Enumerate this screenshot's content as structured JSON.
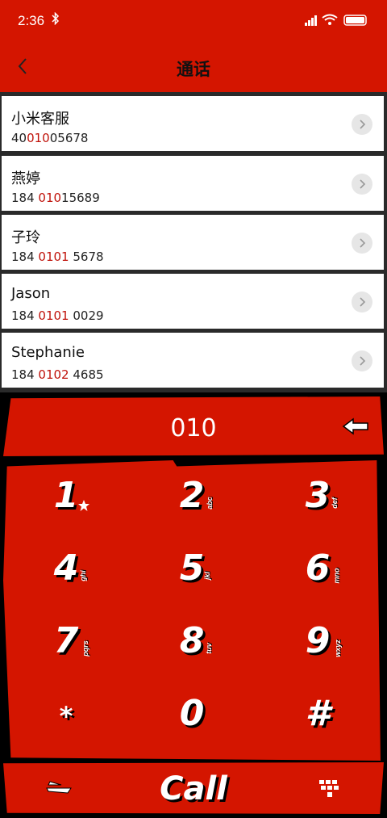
{
  "status": {
    "time": "2:36",
    "bluetooth": "bluetooth-icon",
    "icons": [
      "signal-icon",
      "wifi-icon",
      "battery-icon"
    ]
  },
  "header": {
    "title": "通话"
  },
  "contacts": [
    {
      "name": "小米客服",
      "num_pre": "40",
      "num_hl": "010",
      "num_post": "05678"
    },
    {
      "name": "燕婷",
      "num_pre": "184 ",
      "num_hl": "010",
      "num_post": "15689"
    },
    {
      "name": "子玲",
      "num_pre": "184 ",
      "num_hl": "0101",
      "num_post": " 5678"
    },
    {
      "name": "Jason",
      "num_pre": "184 ",
      "num_hl": "0101",
      "num_post": " 0029"
    },
    {
      "name": "Stephanie",
      "num_pre": "184 ",
      "num_hl": "0102",
      "num_post": " 4685"
    }
  ],
  "dialer": {
    "input": "010",
    "keys": [
      {
        "digit": "1",
        "letters": ""
      },
      {
        "digit": "2",
        "letters": "abc"
      },
      {
        "digit": "3",
        "letters": "def"
      },
      {
        "digit": "4",
        "letters": "ghi"
      },
      {
        "digit": "5",
        "letters": "jkl"
      },
      {
        "digit": "6",
        "letters": "mno"
      },
      {
        "digit": "7",
        "letters": "pqrs"
      },
      {
        "digit": "8",
        "letters": "tuv"
      },
      {
        "digit": "9",
        "letters": "wxyz"
      },
      {
        "digit": "*",
        "letters": ""
      },
      {
        "digit": "0",
        "letters": ""
      },
      {
        "digit": "#",
        "letters": ""
      }
    ],
    "call_label": "Call"
  },
  "colors": {
    "accent": "#d41500",
    "highlight": "#c0120a"
  }
}
